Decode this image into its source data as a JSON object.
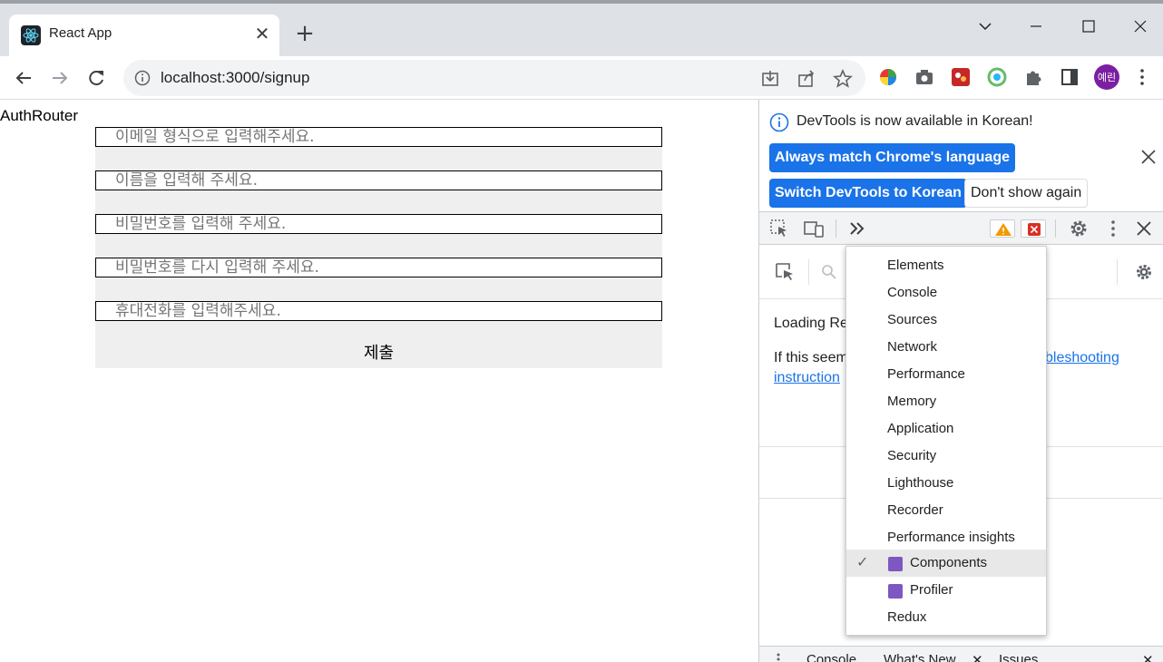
{
  "browser": {
    "tab_title": "React App",
    "tab_close": "✕",
    "new_tab": "+",
    "url": "localhost:3000/signup",
    "avatar_text": "예린"
  },
  "page": {
    "router_label": "AuthRouter",
    "fields": [
      {
        "placeholder": "이메일 형식으로 입력해주세요."
      },
      {
        "placeholder": "이름을 입력해 주세요."
      },
      {
        "placeholder": "비밀번호를 입력해 주세요."
      },
      {
        "placeholder": "비밀번호를 다시 입력해 주세요."
      },
      {
        "placeholder": "휴대전화를 입력해주세요."
      }
    ],
    "submit_label": "제출"
  },
  "devtools": {
    "info_text": "DevTools is now available in Korean!",
    "btn_match": "Always match Chrome's language",
    "btn_switch": "Switch DevTools to Korean",
    "btn_dont_show": "Don't show again",
    "loading_text": "Loading Re",
    "if_text": "If this seem",
    "link_right": "bleshooting",
    "link_left": "instruction",
    "drawer_tabs": [
      "Console",
      "What's New",
      "Issues"
    ],
    "colors": {
      "primary": "#1a73e8",
      "warning": "#f29900",
      "error": "#d93025"
    }
  },
  "menu": {
    "items": [
      {
        "label": "Elements"
      },
      {
        "label": "Console"
      },
      {
        "label": "Sources"
      },
      {
        "label": "Network"
      },
      {
        "label": "Performance"
      },
      {
        "label": "Memory"
      },
      {
        "label": "Application"
      },
      {
        "label": "Security"
      },
      {
        "label": "Lighthouse"
      },
      {
        "label": "Recorder"
      },
      {
        "label": "Performance insights"
      },
      {
        "label": "Components",
        "selected": true,
        "icon": "react-icon"
      },
      {
        "label": "Profiler",
        "icon": "react-icon"
      },
      {
        "label": "Redux"
      }
    ],
    "check": "✓"
  }
}
